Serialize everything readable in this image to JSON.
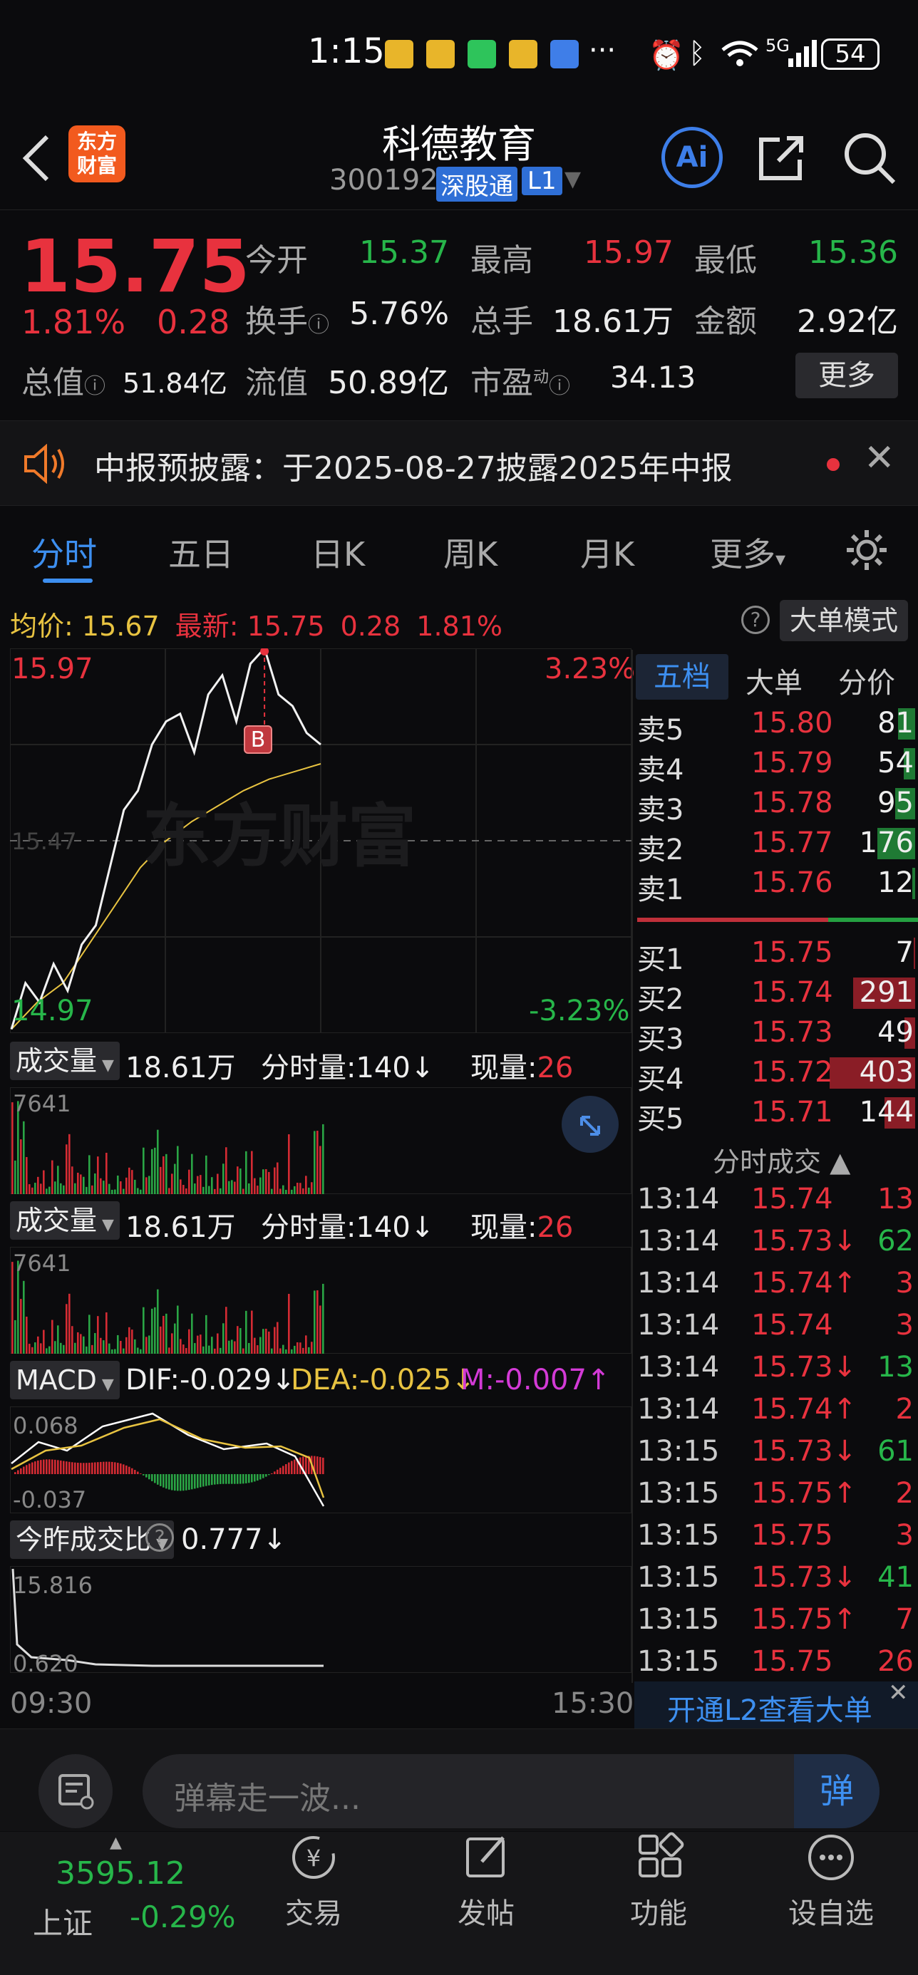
{
  "status_bar": {
    "time": "1:15",
    "more": "···",
    "network": "5G",
    "battery": "54"
  },
  "header": {
    "title": "科德教育",
    "code": "300192",
    "connect_badge": "深股通",
    "level_badge": "L1",
    "logo_line1": "东方",
    "logo_line2": "财富",
    "ai_label": "Ai"
  },
  "quote": {
    "price": "15.75",
    "change_pct": "1.81%",
    "change": "0.28",
    "open_label": "今开",
    "open": "15.37",
    "high_label": "最高",
    "high": "15.97",
    "low_label": "最低",
    "low": "15.36",
    "turnover_label": "换手",
    "turnover": "5.76%",
    "volume_label": "总手",
    "volume": "18.61万",
    "amount_label": "金额",
    "amount": "2.92亿",
    "mcap_label": "总值",
    "mcap": "51.84亿",
    "float_label": "流值",
    "float": "50.89亿",
    "pe_label": "市盈",
    "pe_sup": "动",
    "pe": "34.13",
    "more_button": "更多"
  },
  "notice": {
    "text": "中报预披露：于2025-08-27披露2025年中报"
  },
  "tabs": [
    "分时",
    "五日",
    "日K",
    "周K",
    "月K",
    "更多"
  ],
  "info_line": {
    "avg_label": "均价:",
    "avg": "15.67",
    "latest_label": "最新:",
    "latest": "15.75",
    "change": "0.28",
    "change_pct": "1.81%",
    "help": "?",
    "mode_button": "大单模式"
  },
  "chart": {
    "y_high": "15.97",
    "y_low": "14.97",
    "pct_high": "3.23%",
    "pct_low": "-3.23%",
    "mid_label": "15.47",
    "watermark": "东方财富",
    "marker": "B",
    "time_start": "09:30",
    "time_end": "15:30",
    "chart_data": {
      "type": "line",
      "series": [
        {
          "values": [
            14.98,
            15.1,
            15.05,
            15.15,
            15.08,
            15.2,
            15.25,
            15.4,
            15.55,
            15.6,
            15.72,
            15.78,
            15.8,
            15.7,
            15.85,
            15.9,
            15.78,
            15.93,
            15.97,
            15.85,
            15.82,
            15.75,
            15.72
          ]
        },
        {
          "values": [
            14.98,
            15.05,
            15.1,
            15.2,
            15.3,
            15.4,
            15.47,
            15.52,
            15.56,
            15.6,
            15.63,
            15.65,
            15.67
          ]
        }
      ],
      "ylim": [
        14.97,
        15.97
      ]
    }
  },
  "volume_panel_1": {
    "selector": "成交量",
    "total": "18.61万",
    "tick_label": "分时量:140↓",
    "now_label": "现量:",
    "now": "26",
    "max": "7641"
  },
  "volume_panel_2": {
    "selector": "成交量",
    "total": "18.61万",
    "tick_label": "分时量:140↓",
    "now_label": "现量:",
    "now": "26",
    "max": "7641"
  },
  "macd": {
    "selector": "MACD",
    "dif": "DIF:-0.029↓",
    "dea": "DEA:-0.025↓",
    "m": "M:-0.007↑",
    "top": "0.068",
    "bottom": "-0.037"
  },
  "ratio": {
    "selector": "今昨成交比",
    "help": "?",
    "value": "0.777↓",
    "top": "15.816",
    "bottom": "0.620"
  },
  "orderbook": {
    "tabs": [
      "五档",
      "大单",
      "分价"
    ],
    "asks": [
      {
        "label": "卖5",
        "price": "15.80",
        "qty": "81"
      },
      {
        "label": "卖4",
        "price": "15.79",
        "qty": "54"
      },
      {
        "label": "卖3",
        "price": "15.78",
        "qty": "95"
      },
      {
        "label": "卖2",
        "price": "15.77",
        "qty": "176"
      },
      {
        "label": "卖1",
        "price": "15.76",
        "qty": "12"
      }
    ],
    "bids": [
      {
        "label": "买1",
        "price": "15.75",
        "qty": "7"
      },
      {
        "label": "买2",
        "price": "15.74",
        "qty": "291"
      },
      {
        "label": "买3",
        "price": "15.73",
        "qty": "49"
      },
      {
        "label": "买4",
        "price": "15.72",
        "qty": "403"
      },
      {
        "label": "买5",
        "price": "15.71",
        "qty": "144"
      }
    ],
    "ticks_title": "分时成交 ▲",
    "ticks": [
      {
        "time": "13:14",
        "price": "15.74",
        "qty": "13"
      },
      {
        "time": "13:14",
        "price": "15.73↓",
        "qty": "62"
      },
      {
        "time": "13:14",
        "price": "15.74↑",
        "qty": "3"
      },
      {
        "time": "13:14",
        "price": "15.74",
        "qty": "3"
      },
      {
        "time": "13:14",
        "price": "15.73↓",
        "qty": "13"
      },
      {
        "time": "13:14",
        "price": "15.74↑",
        "qty": "2"
      },
      {
        "time": "13:15",
        "price": "15.73↓",
        "qty": "61"
      },
      {
        "time": "13:15",
        "price": "15.75↑",
        "qty": "2"
      },
      {
        "time": "13:15",
        "price": "15.75",
        "qty": "3"
      },
      {
        "time": "13:15",
        "price": "15.73↓",
        "qty": "41"
      },
      {
        "time": "13:15",
        "price": "15.75↑",
        "qty": "7"
      },
      {
        "time": "13:15",
        "price": "15.75",
        "qty": "26"
      }
    ],
    "l2_banner": "开通L2查看大单"
  },
  "comment": {
    "placeholder": "弹幕走一波...",
    "send": "弹"
  },
  "bottom_nav": {
    "index_value": "3595.12",
    "index_name": "上证",
    "index_change": "-0.29%",
    "items": [
      "交易",
      "发帖",
      "功能",
      "设自选"
    ]
  }
}
